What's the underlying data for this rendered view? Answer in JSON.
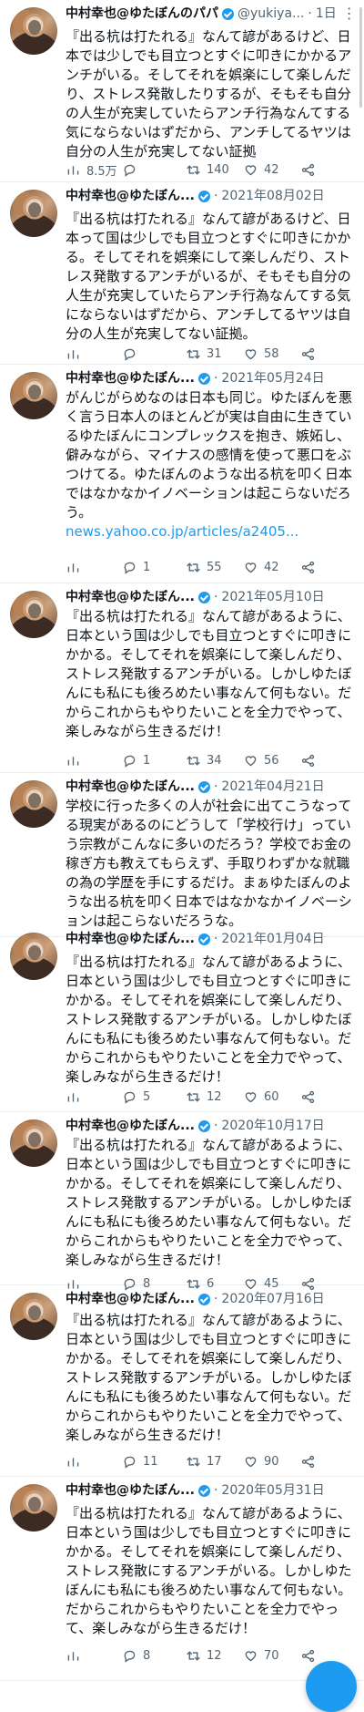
{
  "tweets": [
    {
      "name": "中村幸也@ゆたぼんのパパ",
      "handle": "@yukiya...",
      "date": "1日",
      "verified": true,
      "text": "『出る杭は打たれる』なんて諺があるけど、日本では少しでも目立つとすぐに叩きにかかるアンチがいる。そしてそれを娯楽にして楽しんだり、ストレス発散したりするが、そもそも自分の人生が充実していたらアンチ行為なんてする気にならないはずだから、アンチしてるヤツは自分の人生が充実してない証拠",
      "link": "",
      "views": "8.5万",
      "replies": "",
      "retweets": "140",
      "likes": "42"
    },
    {
      "name": "中村幸也@ゆたぼん...",
      "handle": "",
      "date": "2021年08月02日",
      "verified": true,
      "text": "『出る杭は打たれる』なんて諺があるけど、日本って国は少しでも目立つとすぐに叩きにかかる。そしてそれを娯楽にして楽しんだり、ストレス発散するアンチがいるが、そもそも自分の人生が充実していたらアンチ行為なんてする気にならないはずだから、アンチしてるヤツは自分の人生が充実してない証拠。",
      "link": "",
      "views": "",
      "replies": "",
      "retweets": "31",
      "likes": "58"
    },
    {
      "name": "中村幸也@ゆたぼん...",
      "handle": "",
      "date": "2021年05月24日",
      "verified": true,
      "text": "がんじがらめなのは日本も同じ。ゆたぼんを悪く言う日本人のほとんどが実は自由に生きているゆたぼんにコンプレックスを抱き、嫉妬し、僻みながら、マイナスの感情を使って悪口をぶつけてる。ゆたぼんのような出る杭を叩く日本ではなかなかイノベーションは起こらないだろう。",
      "link": "news.yahoo.co.jp/articles/a2405...",
      "views": "",
      "replies": "1",
      "retweets": "55",
      "likes": "42"
    },
    {
      "name": "中村幸也@ゆたぼん...",
      "handle": "",
      "date": "2021年05月10日",
      "verified": true,
      "text": "『出る杭は打たれる』なんて諺があるように、日本という国は少しでも目立つとすぐに叩きにかかる。そしてそれを娯楽にして楽しんだり、ストレス発散するアンチがいる。しかしゆたぼんにも私にも後ろめたい事なんて何もない。だからこれからもやりたいことを全力でやって、楽しみながら生きるだけ！",
      "link": "",
      "views": "",
      "replies": "1",
      "retweets": "34",
      "likes": "56"
    },
    {
      "name": "中村幸也@ゆたぼん...",
      "handle": "",
      "date": "2021年04月21日",
      "verified": true,
      "text": "学校に行った多くの人が社会に出てこうなってる現実があるのにどうして「学校行け」っていう宗教がこんなに多いのだろう？学校でお金の稼ぎ方も教えてもらえず、手取りわずかな就職の為の学歴を手にするだけ。まぁゆたぼんのような出る杭を叩く日本ではなかなかイノベーションは起こらないだろうな。",
      "link": "",
      "views": "",
      "replies": "",
      "retweets": "",
      "likes": ""
    },
    {
      "name": "中村幸也@ゆたぼん...",
      "handle": "",
      "date": "2021年01月04日",
      "verified": true,
      "text": "『出る杭は打たれる』なんて諺があるように、日本という国は少しでも目立つとすぐに叩きにかかる。そしてそれを娯楽にして楽しんだり、ストレス発散するアンチがいる。しかしゆたぼんにも私にも後ろめたい事なんて何もない。だからこれからもやりたいことを全力でやって、楽しみながら生きるだけ！",
      "link": "",
      "views": "",
      "replies": "5",
      "retweets": "12",
      "likes": "60"
    },
    {
      "name": "中村幸也@ゆたぼん...",
      "handle": "",
      "date": "2020年10月17日",
      "verified": true,
      "text": "『出る杭は打たれる』なんて諺があるように、日本という国は少しでも目立つとすぐに叩きにかかる。そしてそれを娯楽にして楽しんだり、ストレス発散するアンチがいる。しかしゆたぼんにも私にも後ろめたい事なんて何もない。だからこれからもやりたいことを全力でやって、楽しみながら生きるだけ！",
      "link": "",
      "views": "",
      "replies": "8",
      "retweets": "6",
      "likes": "45"
    },
    {
      "name": "中村幸也@ゆたぼん...",
      "handle": "",
      "date": "2020年07月16日",
      "verified": true,
      "text": "『出る杭は打たれる』なんて諺があるように、日本という国は少しでも目立つとすぐに叩きにかかる。そしてそれを娯楽にして楽しんだり、ストレス発散するアンチがいる。しかしゆたぼんにも私にも後ろめたい事なんて何もない。だからこれからもやりたいことを全力でやって、楽しみながら生きるだけ！",
      "link": "",
      "views": "",
      "replies": "11",
      "retweets": "17",
      "likes": "90"
    },
    {
      "name": "中村幸也@ゆたぼん...",
      "handle": "",
      "date": "2020年05月31日",
      "verified": true,
      "text": "『出る杭は打たれる』なんて諺があるように、日本という国は少しでも目立つとすぐに叩きにかかる。そしてそれを娯楽にして楽しんだり、ストレス発散にするアンチがいる。しかしゆたぼんにも私にも後ろめたい事なんて何もない。だからこれからもやりたいことを全力でやって、楽しみながら生きるだけ！",
      "link": "",
      "views": "",
      "replies": "8",
      "retweets": "12",
      "likes": "70"
    }
  ]
}
